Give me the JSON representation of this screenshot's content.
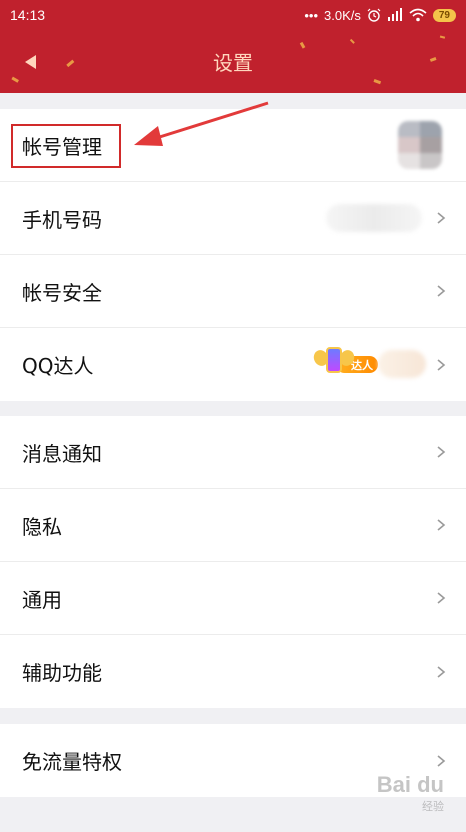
{
  "status_bar": {
    "time": "14:13",
    "network_speed": "3.0K/s",
    "battery": "79"
  },
  "header": {
    "title": "设置",
    "back_icon": "back-arrow-icon",
    "colors": {
      "bar": "#c0212d",
      "title": "#ffd6bd"
    }
  },
  "sections": [
    {
      "items": [
        {
          "label": "帐号管理"
        },
        {
          "label": "手机号码"
        },
        {
          "label": "帐号安全"
        },
        {
          "label": "QQ达人",
          "badge_text": "达人"
        }
      ]
    },
    {
      "items": [
        {
          "label": "消息通知"
        },
        {
          "label": "隐私"
        },
        {
          "label": "通用"
        },
        {
          "label": "辅助功能"
        }
      ]
    },
    {
      "items": [
        {
          "label": "免流量特权"
        }
      ]
    }
  ],
  "watermark": {
    "brand": "Bai du",
    "sub": "经验"
  },
  "annotation_color": "#d12a2a"
}
